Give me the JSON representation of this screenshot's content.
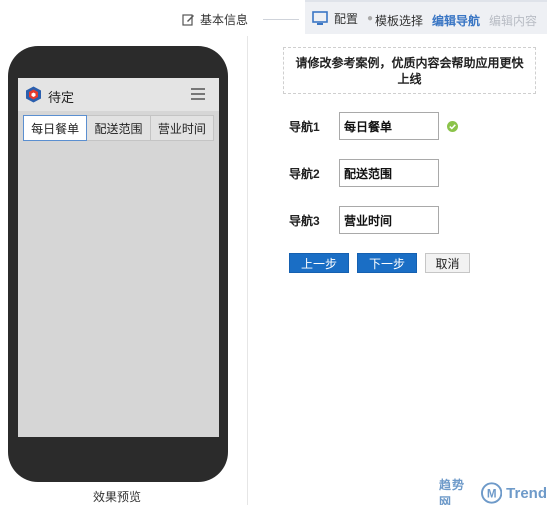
{
  "steps": {
    "basic_info": "基本信息",
    "config": "配置",
    "template_select": "模板选择",
    "edit_nav": "编辑导航",
    "edit_content": "编辑内容"
  },
  "preview": {
    "app_title": "待定",
    "tabs": [
      "每日餐单",
      "配送范围",
      "营业时间"
    ],
    "label": "效果预览"
  },
  "notice": "请修改参考案例，优质内容会帮助应用更快上线",
  "nav_fields": [
    {
      "label": "导航1",
      "value": "每日餐单"
    },
    {
      "label": "导航2",
      "value": "配送范围"
    },
    {
      "label": "导航3",
      "value": "营业时间"
    }
  ],
  "buttons": {
    "prev": "上一步",
    "next": "下一步",
    "cancel": "取消"
  },
  "watermark": {
    "cn": "趋势网",
    "en": "Trend"
  },
  "colors": {
    "primary": "#1a6ec5",
    "active_step": "#3a76c4",
    "phone": "#2b2b2b",
    "check": "#8bc34a"
  }
}
